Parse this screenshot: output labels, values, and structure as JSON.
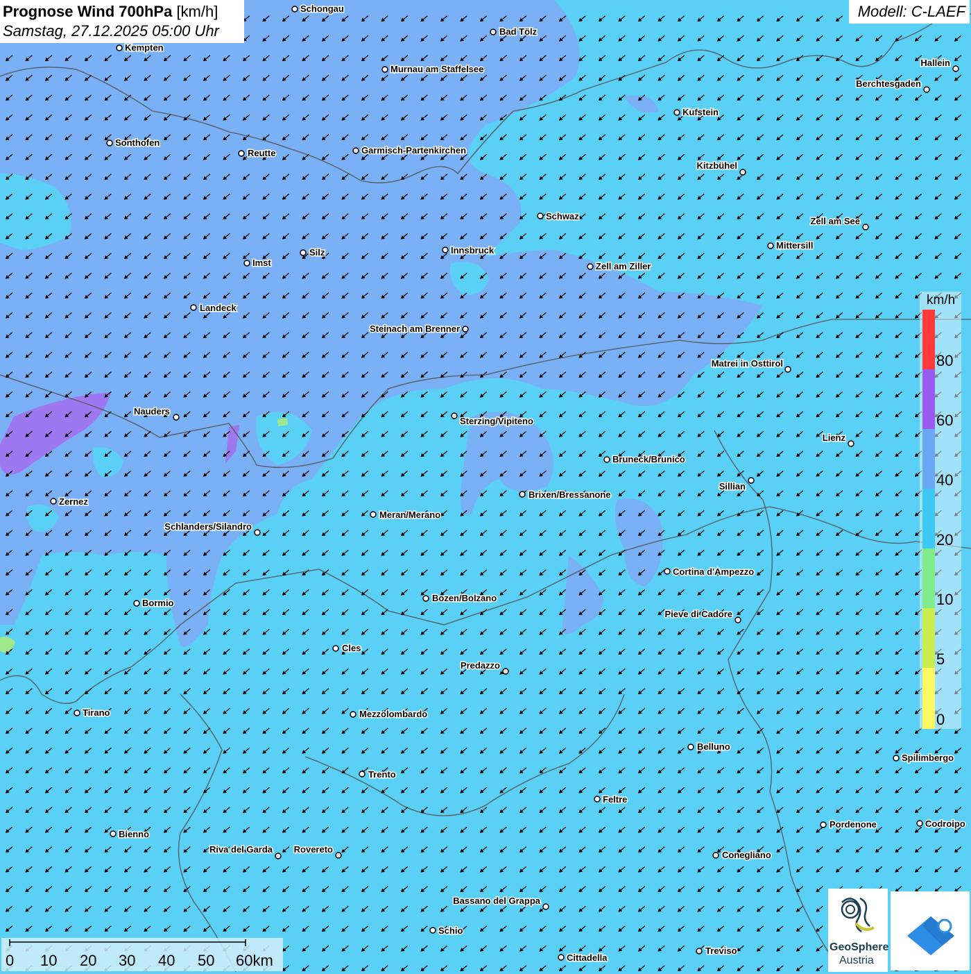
{
  "header": {
    "title_bold": "Prognose Wind 700hPa",
    "title_unit": "[km/h]",
    "subtitle": "Samstag, 27.12.2025 05:00 Uhr"
  },
  "model_label": "Modell: C-LAEF",
  "legend": {
    "unit": "km/h",
    "ticks": [
      "80",
      "60",
      "40",
      "20",
      "10",
      "5",
      "0"
    ],
    "colors": [
      "#ff3a3a",
      "#9a5cf0",
      "#6aa8f5",
      "#40c8f5",
      "#80ec8c",
      "#c8ee50",
      "#fff966"
    ]
  },
  "scale": {
    "labels": [
      "0",
      "10",
      "20",
      "30",
      "40",
      "50",
      "60km"
    ]
  },
  "logo": {
    "name_line1": "GeoSphere",
    "name_line2": "Austria"
  },
  "colors": {
    "background_20_40": "#5ad0f6",
    "region_40_60": "#7ab0f5",
    "region_60_80": "#a46ef0",
    "region_10_20": "#9ee88c",
    "borders": "#555555",
    "arrows": "#000000",
    "app_icon": "#2c8ce6"
  },
  "cities": [
    {
      "name": "Schongau"
    },
    {
      "name": "Bad Tölz"
    },
    {
      "name": "Kempten"
    },
    {
      "name": "Murnau am Staffelsee"
    },
    {
      "name": "Hallein"
    },
    {
      "name": "Berchtesgaden"
    },
    {
      "name": "Kufstein"
    },
    {
      "name": "Sonthofen"
    },
    {
      "name": "Reutte"
    },
    {
      "name": "Garmisch-Partenkirchen"
    },
    {
      "name": "Kitzbühel"
    },
    {
      "name": "Schwaz"
    },
    {
      "name": "Zell am See"
    },
    {
      "name": "Mittersill"
    },
    {
      "name": "Silz"
    },
    {
      "name": "Innsbruck"
    },
    {
      "name": "Imst"
    },
    {
      "name": "Zell am Ziller"
    },
    {
      "name": "Landeck"
    },
    {
      "name": "Steinach am Brenner"
    },
    {
      "name": "Matrei in Osttirol"
    },
    {
      "name": "Nauders"
    },
    {
      "name": "Sterzing/Vipiteno"
    },
    {
      "name": "Lienz"
    },
    {
      "name": "Bruneck/Brunico"
    },
    {
      "name": "Sillian"
    },
    {
      "name": "Zernez"
    },
    {
      "name": "Brixen/Bressanone"
    },
    {
      "name": "Meran/Merano"
    },
    {
      "name": "Schlanders/Silandro"
    },
    {
      "name": "Cortina d'Ampezzo"
    },
    {
      "name": "Bozen/Bolzano"
    },
    {
      "name": "Bormio"
    },
    {
      "name": "Pieve di Cadore"
    },
    {
      "name": "Cles"
    },
    {
      "name": "Predazzo"
    },
    {
      "name": "Tirano"
    },
    {
      "name": "Mezzolombardo"
    },
    {
      "name": "Belluno"
    },
    {
      "name": "Spilimbergo"
    },
    {
      "name": "Trento"
    },
    {
      "name": "Feltre"
    },
    {
      "name": "Pordenone"
    },
    {
      "name": "Codroipo"
    },
    {
      "name": "Bienno"
    },
    {
      "name": "Riva del Garda"
    },
    {
      "name": "Rovereto"
    },
    {
      "name": "Conegliano"
    },
    {
      "name": "Bassano del Grappa"
    },
    {
      "name": "Schio"
    },
    {
      "name": "Treviso"
    },
    {
      "name": "Cittadella"
    }
  ]
}
